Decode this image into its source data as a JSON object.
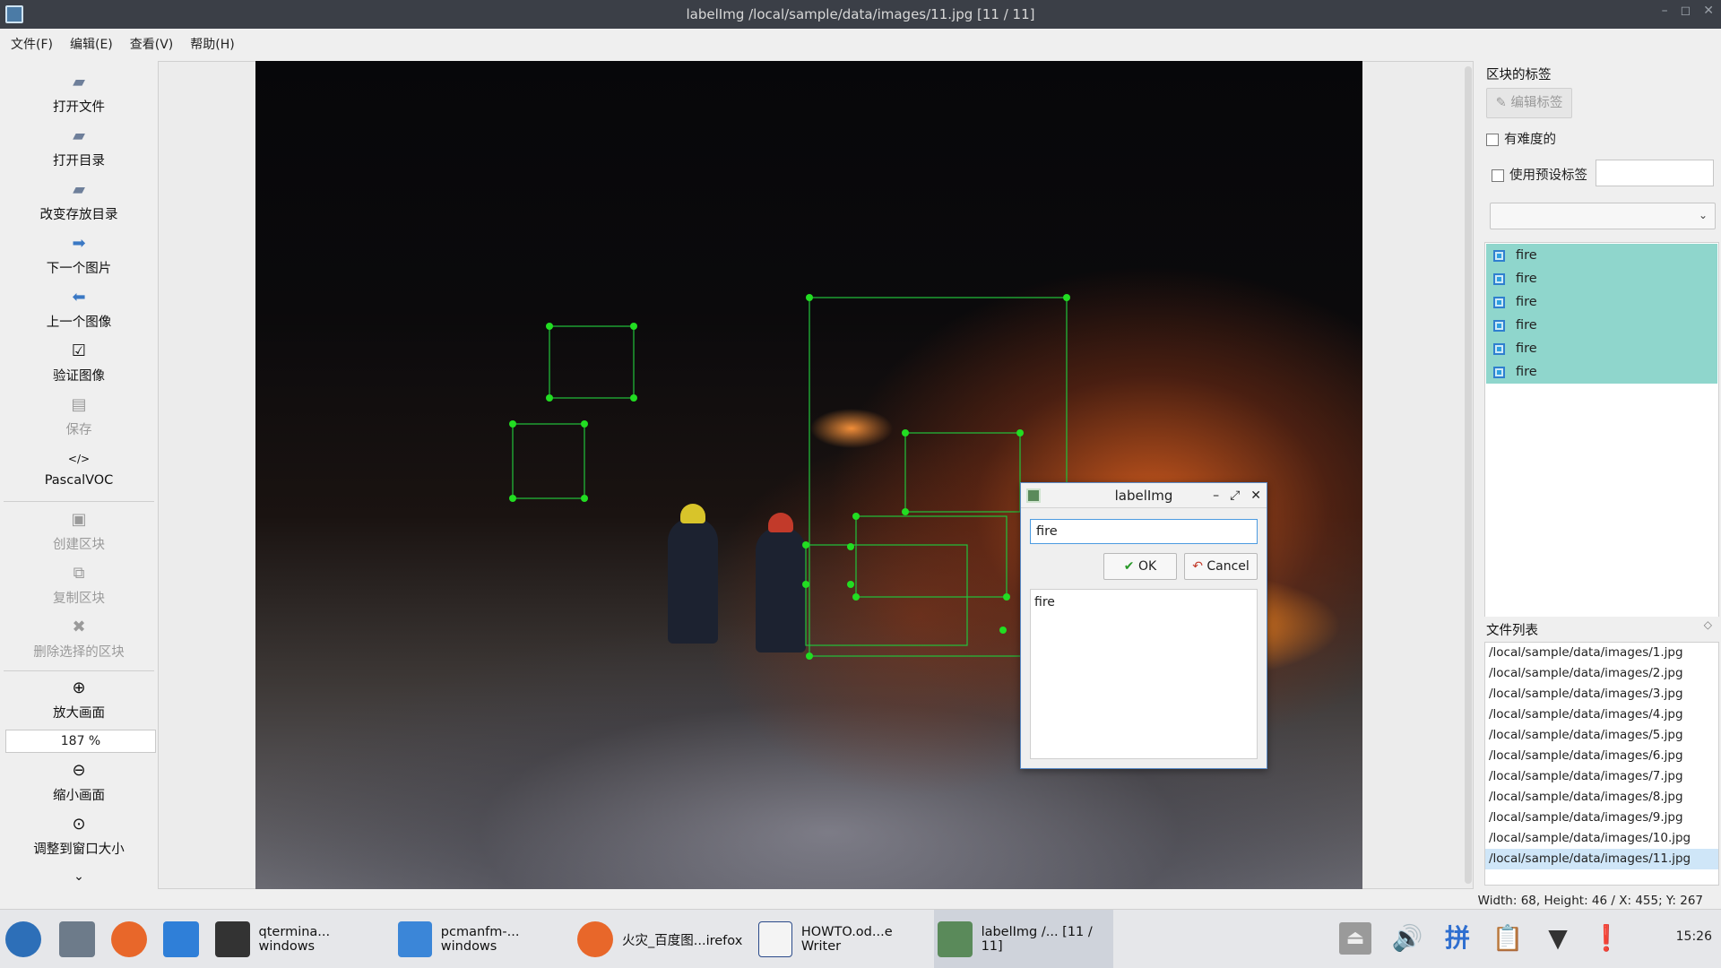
{
  "window": {
    "title": "labelImg /local/sample/data/images/11.jpg [11 / 11]"
  },
  "menu": [
    "文件(F)",
    "编辑(E)",
    "查看(V)",
    "帮助(H)"
  ],
  "toolbar": {
    "open_file": "打开文件",
    "open_dir": "打开目录",
    "change_save_dir": "改变存放目录",
    "next_image": "下一个图片",
    "prev_image": "上一个图像",
    "verify_image": "验证图像",
    "save": "保存",
    "format_icon": "</>",
    "format": "PascalVOC",
    "create_box": "创建区块",
    "duplicate_box": "复制区块",
    "delete_box": "删除选择的区块",
    "zoom_in": "放大画面",
    "zoom_value": "187 %",
    "zoom_out": "缩小画面",
    "fit_window": "调整到窗口大小"
  },
  "labels_dock": {
    "title": "区块的标签",
    "edit_label": "编辑标签",
    "difficult": "有难度的",
    "use_default": "使用预设标签",
    "default_value": "",
    "items": [
      "fire",
      "fire",
      "fire",
      "fire",
      "fire",
      "fire"
    ]
  },
  "files_dock": {
    "title": "文件列表",
    "files": [
      "/local/sample/data/images/1.jpg",
      "/local/sample/data/images/2.jpg",
      "/local/sample/data/images/3.jpg",
      "/local/sample/data/images/4.jpg",
      "/local/sample/data/images/5.jpg",
      "/local/sample/data/images/6.jpg",
      "/local/sample/data/images/7.jpg",
      "/local/sample/data/images/8.jpg",
      "/local/sample/data/images/9.jpg",
      "/local/sample/data/images/10.jpg",
      "/local/sample/data/images/11.jpg"
    ],
    "selected_index": 10
  },
  "status": {
    "text": "Width: 68, Height: 46 / X: 455; Y: 267"
  },
  "dialog": {
    "title": "labelImg",
    "input_value": "fire",
    "ok": "OK",
    "cancel": "Cancel",
    "list": [
      "fire"
    ]
  },
  "taskbar": {
    "tasks": [
      "qtermina... windows",
      "pcmanfm-... windows",
      "火灾_百度图...irefox",
      "HOWTO.od...e Writer",
      "labelImg /... [11 / 11]"
    ],
    "ime": "拼",
    "clock": "15:26"
  },
  "colors": {
    "accent": "#4c9be0",
    "label_bg": "#8fd6cc",
    "box_stroke": "#22c33b"
  }
}
